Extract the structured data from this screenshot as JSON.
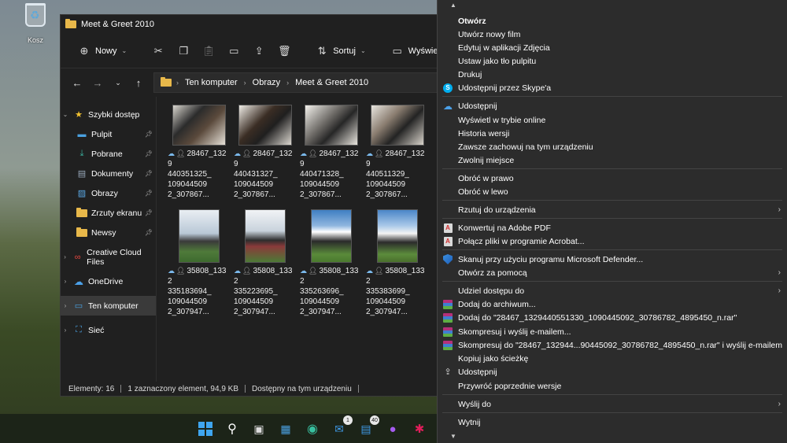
{
  "desktop": {
    "recycle_bin_label": "Kosz"
  },
  "window": {
    "title": "Meet & Greet 2010"
  },
  "toolbar": {
    "new_label": "Nowy",
    "sort_label": "Sortuj",
    "view_label": "Wyświetl"
  },
  "address": {
    "crumbs": [
      "Ten komputer",
      "Obrazy",
      "Meet & Greet 2010"
    ]
  },
  "navpane": {
    "quick_access": "Szybki dostęp",
    "items": [
      "Pulpit",
      "Pobrane",
      "Dokumenty",
      "Obrazy",
      "Zrzuty ekranu",
      "Newsy"
    ],
    "creative_cloud": "Creative Cloud Files",
    "onedrive": "OneDrive",
    "this_pc": "Ten komputer",
    "network": "Sieć"
  },
  "files": [
    {
      "line1": "28467_1329",
      "line2": "440351325_",
      "line3": "109044509",
      "line4": "2_307867..."
    },
    {
      "line1": "28467_1329",
      "line2": "440431327_",
      "line3": "109044509",
      "line4": "2_307867..."
    },
    {
      "line1": "28467_1329",
      "line2": "440471328_",
      "line3": "109044509",
      "line4": "2_307867..."
    },
    {
      "line1": "28467_1329",
      "line2": "440511329_",
      "line3": "109044509",
      "line4": "2_307867..."
    },
    {
      "line1": "35808_1332",
      "line2": "335183694_",
      "line3": "109044509",
      "line4": "2_307947..."
    },
    {
      "line1": "35808_1332",
      "line2": "335223695_",
      "line3": "109044509",
      "line4": "2_307947..."
    },
    {
      "line1": "35808_1332",
      "line2": "335263696_",
      "line3": "109044509",
      "line4": "2_307947..."
    },
    {
      "line1": "35808_1332",
      "line2": "335383699_",
      "line3": "109044509",
      "line4": "2_307947..."
    }
  ],
  "status": {
    "count": "Elementy: 16",
    "selected": "1 zaznaczony element, 94,9 KB",
    "availability": "Dostępny na tym urządzeniu"
  },
  "context_menu": {
    "open": "Otwórz",
    "new_video": "Utwórz nowy film",
    "edit_photos": "Edytuj w aplikacji Zdjęcia",
    "set_background": "Ustaw jako tło pulpitu",
    "print": "Drukuj",
    "skype_share": "Udostępnij przez Skype'a",
    "share_onedrive": "Udostępnij",
    "view_online": "Wyświetl w trybie online",
    "version_history": "Historia wersji",
    "always_keep": "Zawsze zachowuj na tym urządzeniu",
    "free_space": "Zwolnij miejsce",
    "rotate_right": "Obróć w prawo",
    "rotate_left": "Obróć w lewo",
    "cast": "Rzutuj do urządzenia",
    "convert_pdf": "Konwertuj na Adobe PDF",
    "combine_acrobat": "Połącz pliki w programie Acrobat...",
    "defender_scan": "Skanuj przy użyciu programu Microsoft Defender...",
    "open_with": "Otwórz za pomocą",
    "give_access": "Udziel dostępu do",
    "add_archive": "Dodaj do archiwum...",
    "add_to_rar": "Dodaj do \"28467_1329440551330_1090445092_30786782_4895450_n.rar\"",
    "compress_email": "Skompresuj i wyślij e-mailem...",
    "compress_to_rar_email": "Skompresuj do \"28467_132944...90445092_30786782_4895450_n.rar\" i wyślij e-mailem",
    "copy_path": "Kopiuj jako ścieżkę",
    "share": "Udostępnij",
    "restore_versions": "Przywróć poprzednie wersje",
    "send_to": "Wyślij do",
    "cut": "Wytnij"
  },
  "taskbar": {
    "mail_badge": "1",
    "app_badge": "40"
  }
}
